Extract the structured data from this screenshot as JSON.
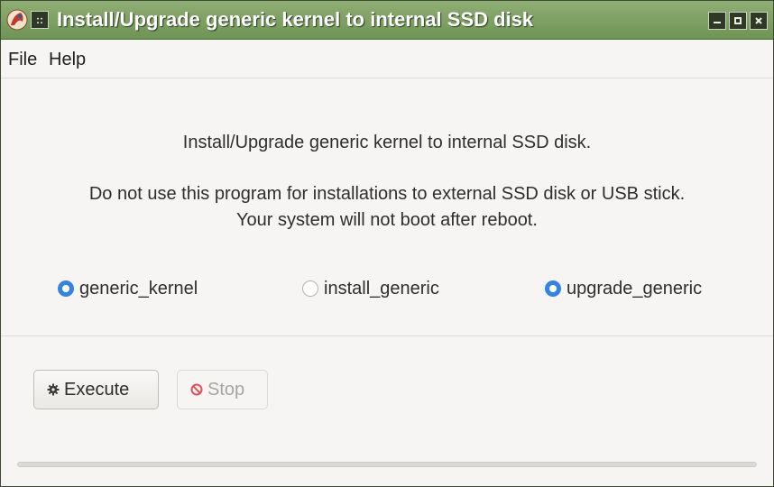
{
  "window": {
    "title": "Install/Upgrade generic kernel to internal SSD disk",
    "menu_button_glyph": "::",
    "controls": {
      "minimize": "minimize-icon",
      "maximize": "maximize-icon",
      "close": "close-icon"
    }
  },
  "menubar": {
    "file": "File",
    "help": "Help"
  },
  "main": {
    "heading": "Install/Upgrade generic kernel to internal SSD disk.",
    "warning_line1": "Do not use this program for installations to external SSD disk or USB stick.",
    "warning_line2": "Your system will not boot after reboot."
  },
  "options": [
    {
      "label": "generic_kernel",
      "selected": true
    },
    {
      "label": "install_generic",
      "selected": false
    },
    {
      "label": "upgrade_generic",
      "selected": true
    }
  ],
  "buttons": {
    "execute": {
      "label": "Execute",
      "icon": "gear-icon",
      "enabled": true
    },
    "stop": {
      "label": "Stop",
      "icon": "stop-icon",
      "enabled": false
    }
  },
  "progress": {
    "value": 0
  },
  "colors": {
    "titlebar": "#7fa364",
    "accent": "#3584e4",
    "stop_icon": "#e0505a"
  }
}
